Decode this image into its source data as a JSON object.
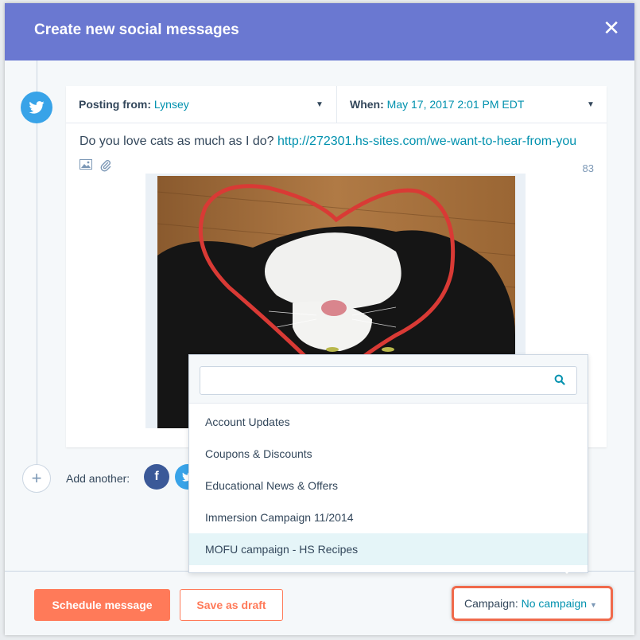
{
  "header": {
    "title": "Create new social messages"
  },
  "composer": {
    "posting_from_label": "Posting from:",
    "account": "Lynsey",
    "when_label": "When:",
    "when_value": "May 17, 2017 2:01 PM EDT",
    "message_text": "Do you love cats as much as I do?",
    "message_link": "http://272301.hs-sites.com/we-want-to-hear-from-you",
    "char_count": "83"
  },
  "add_another": {
    "label": "Add another:",
    "networks": [
      "facebook-icon",
      "twitter-icon"
    ]
  },
  "campaign_dropdown": {
    "search_value": "",
    "items": [
      "Account Updates",
      "Coupons & Discounts",
      "Educational News & Offers",
      "Immersion Campaign 11/2014",
      "MOFU campaign - HS Recipes"
    ],
    "highlighted_index": 4
  },
  "footer": {
    "schedule_label": "Schedule message",
    "draft_label": "Save as draft",
    "campaign_label": "Campaign:",
    "campaign_value": "No campaign"
  },
  "colors": {
    "header": "#6a78d1",
    "accent": "#0091ae",
    "primary_button": "#ff7a59",
    "twitter": "#38a3e8",
    "facebook": "#3b5998"
  }
}
